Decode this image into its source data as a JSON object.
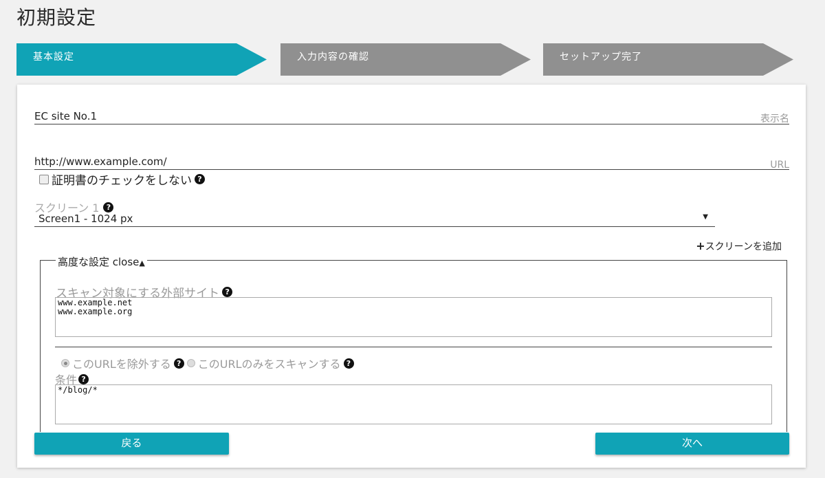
{
  "page": {
    "title": "初期設定"
  },
  "steps": [
    {
      "label": "基本設定",
      "active": true
    },
    {
      "label": "入力内容の確認",
      "active": false
    },
    {
      "label": "セットアップ完了",
      "active": false
    }
  ],
  "form": {
    "display_name": {
      "value": "EC site No.1",
      "label": "表示名"
    },
    "url": {
      "value": "http://www.example.com/",
      "label": "URL"
    },
    "cert_check": {
      "label": "証明書のチェックをしない",
      "checked": false
    },
    "screen": {
      "label": "スクリーン 1",
      "selected": "Screen1 - 1024 px"
    },
    "add_screen": "スクリーンを追加",
    "advanced": {
      "legend": "高度な設定 close",
      "external_sites_label": "スキャン対象にする外部サイト",
      "external_sites_value": "www.example.net\nwww.example.org",
      "radio_exclude": "このURLを除外する",
      "radio_only": "このURLのみをスキャンする",
      "selected_radio": "exclude",
      "condition_label": "条件",
      "condition_value": "*/blog/*"
    }
  },
  "buttons": {
    "back": "戻る",
    "next": "次へ"
  },
  "colors": {
    "accent": "#10a3b6",
    "inactive_step": "#909090"
  }
}
